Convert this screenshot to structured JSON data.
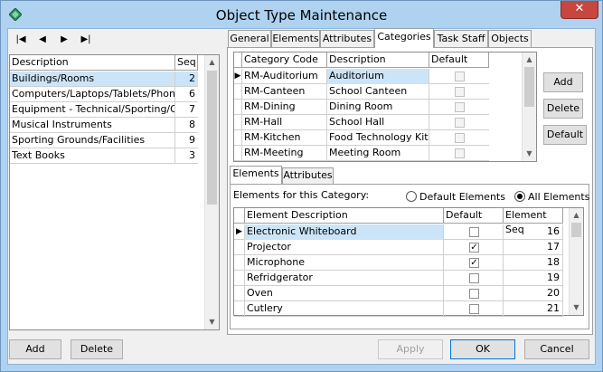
{
  "window": {
    "title": "Object Type Maintenance"
  },
  "nav": {
    "first": "|◀",
    "prev": "◀",
    "next": "▶",
    "last": "▶|"
  },
  "left_grid": {
    "headers": [
      "Description",
      "Seq"
    ],
    "rows": [
      {
        "description": "Buildings/Rooms",
        "seq": "2",
        "selected": true
      },
      {
        "description": "Computers/Laptops/Tablets/Phones",
        "seq": "6"
      },
      {
        "description": "Equipment - Technical/Sporting/Other",
        "seq": "7"
      },
      {
        "description": "Musical Instruments",
        "seq": "8"
      },
      {
        "description": "Sporting Grounds/Facilities",
        "seq": "9"
      },
      {
        "description": "Text Books",
        "seq": "3"
      }
    ]
  },
  "tabs": [
    "General",
    "Elements",
    "Attributes",
    "Categories",
    "Task Staff",
    "Objects"
  ],
  "active_tab": "Categories",
  "categories_grid": {
    "headers": [
      "Category Code",
      "Description",
      "Default"
    ],
    "rows": [
      {
        "code": "RM-Auditorium",
        "description": "Auditorium",
        "default": false
      },
      {
        "code": "RM-Canteen",
        "description": "School Canteen",
        "default": false
      },
      {
        "code": "RM-Dining",
        "description": "Dining Room",
        "default": false
      },
      {
        "code": "RM-Hall",
        "description": "School Hall",
        "default": false
      },
      {
        "code": "RM-Kitchen",
        "description": "Food Technology Kitche",
        "default": false
      },
      {
        "code": "RM-Meeting",
        "description": "Meeting Room",
        "default": false
      }
    ]
  },
  "side_buttons": {
    "add": "Add",
    "delete": "Delete",
    "default": "Default"
  },
  "inner_tabs": [
    "Elements",
    "Attributes"
  ],
  "elements_label": "Elements for this Category:",
  "radios": {
    "default_elements": "Default Elements",
    "all_elements": "All Elements"
  },
  "elements_grid": {
    "headers": [
      "Element Description",
      "Default",
      "Element Seq"
    ],
    "rows": [
      {
        "description": "Electronic Whiteboard",
        "default": false,
        "seq": "16"
      },
      {
        "description": "Projector",
        "default": true,
        "seq": "17"
      },
      {
        "description": "Microphone",
        "default": true,
        "seq": "18"
      },
      {
        "description": "Refridgerator",
        "default": false,
        "seq": "19"
      },
      {
        "description": "Oven",
        "default": false,
        "seq": "20"
      },
      {
        "description": "Cutlery",
        "default": false,
        "seq": "21"
      }
    ]
  },
  "bottom_buttons": {
    "add": "Add",
    "delete": "Delete",
    "apply": "Apply",
    "ok": "OK",
    "cancel": "Cancel"
  },
  "close_glyph": "✕",
  "check_glyph": "✓"
}
